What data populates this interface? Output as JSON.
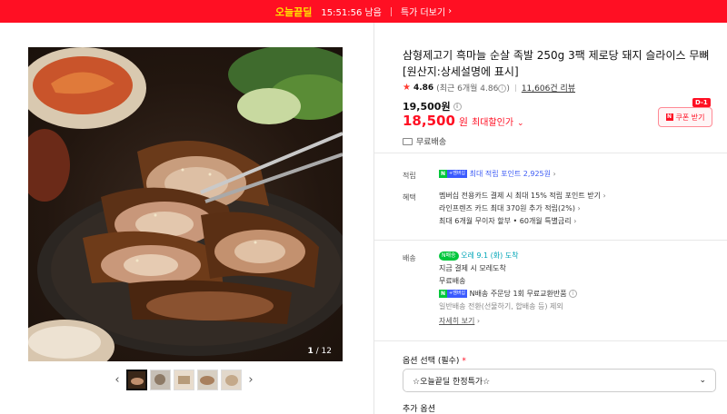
{
  "banner": {
    "deal_label": "오늘끝딜",
    "timer": "15:51:56 남음",
    "more_label": "특가 더보기",
    "more_chevron": "›"
  },
  "gallery": {
    "page_current": "1",
    "page_total": "/ 12",
    "prev_arrow": "‹",
    "next_arrow": "›",
    "thumbnail_count": 5,
    "active_thumbnail": 1
  },
  "product": {
    "title": "삼형제고기 흑마늘 순살 족발 250g 3팩 제로당 돼지 슬라이스 무뼈 [원산지:상세설명에 표시]",
    "rating": {
      "score": "4.86",
      "recent": "(최근 6개월 4.86",
      "recent_close": ")",
      "reviews": "11,606건 리뷰"
    },
    "original_price": "19,500원",
    "sale_price": "18,500",
    "sale_won": "원",
    "sale_label": "최대할인가",
    "coupon": {
      "tag": "D-1",
      "label": "쿠폰 받기",
      "nbadge": "N"
    },
    "shipping": "무료배송"
  },
  "benefits": {
    "points_label": "적립",
    "points_badge_n": "N",
    "points_badge_plus": "+멤버십",
    "points_text": "최대 적립 포인트 2,925원",
    "benefit_label": "혜택",
    "benefit_lines": [
      "멤버십 전용카드 결제 시 최대 15% 적립 포인트 받기",
      "라인프렌즈 카드 최대 370원 추가 적립(2%)",
      "최대 6개월 무이자 할부 • 60개월 특별금리"
    ]
  },
  "delivery": {
    "label": "배송",
    "badge": "N배송",
    "arrival": "오레 9.1 (화) 도착",
    "line1": "지금 결제 시 모레도착",
    "line2": "무료배송",
    "badge_n": "N",
    "badge_plus": "+멤버십",
    "line3": "N배송 주문당 1회 무료교환반품",
    "line4": "일반배송 전환(선물하기, 합배송 등) 제외",
    "more_link": "자세히 보기"
  },
  "options": {
    "select_label": "옵션 선택 (필수)",
    "required_mark": "*",
    "select_value": "☆오늘끝딜 한정특가☆",
    "select_chevron": "⌄",
    "add_label": "추가 옵션"
  },
  "colors": {
    "brand_red": "#ff0f23",
    "naver_green": "#00c73c",
    "link_blue": "#3c5bf5"
  }
}
